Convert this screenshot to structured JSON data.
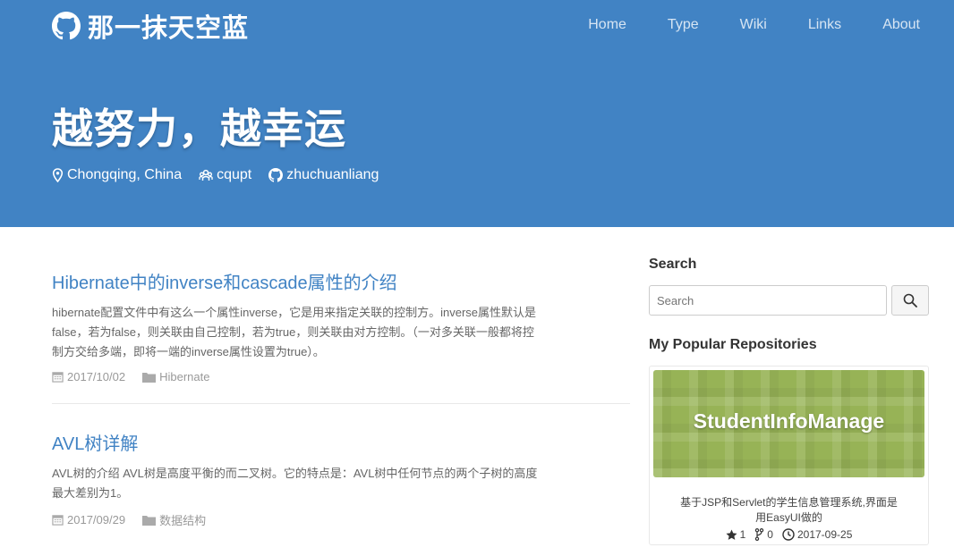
{
  "site": {
    "title": "那一抹天空蓝"
  },
  "nav": {
    "items": [
      "Home",
      "Type",
      "Wiki",
      "Links",
      "About"
    ]
  },
  "hero": {
    "title": "越努力，越幸运",
    "location": "Chongqing, China",
    "org": "cqupt",
    "github": "zhuchuanliang"
  },
  "posts": [
    {
      "title": "Hibernate中的inverse和cascade属性的介绍",
      "excerpt": "hibernate配置文件中有这么一个属性inverse，它是用来指定关联的控制方。inverse属性默认是false，若为false，则关联由自己控制，若为true，则关联由对方控制。（一对多关联一般都将控制方交给多端，即将一端的inverse属性设置为true）。",
      "date": "2017/10/02",
      "category": "Hibernate"
    },
    {
      "title": "AVL树详解",
      "excerpt": "AVL树的介绍 AVL树是高度平衡的而二叉树。它的特点是：AVL树中任何节点的两个子树的高度最大差别为1。",
      "date": "2017/09/29",
      "category": "数据结构"
    }
  ],
  "sidebar": {
    "search_title": "Search",
    "search_placeholder": "Search",
    "repos_title": "My Popular Repositories",
    "repo": {
      "name": "StudentInfoManage",
      "description": "基于JSP和Servlet的学生信息管理系统,界面是用EasyUI做的",
      "stars": "1",
      "forks": "0",
      "updated": "2017-09-25"
    }
  },
  "colors": {
    "accent": "#4183c4",
    "banner": "#97b356"
  }
}
